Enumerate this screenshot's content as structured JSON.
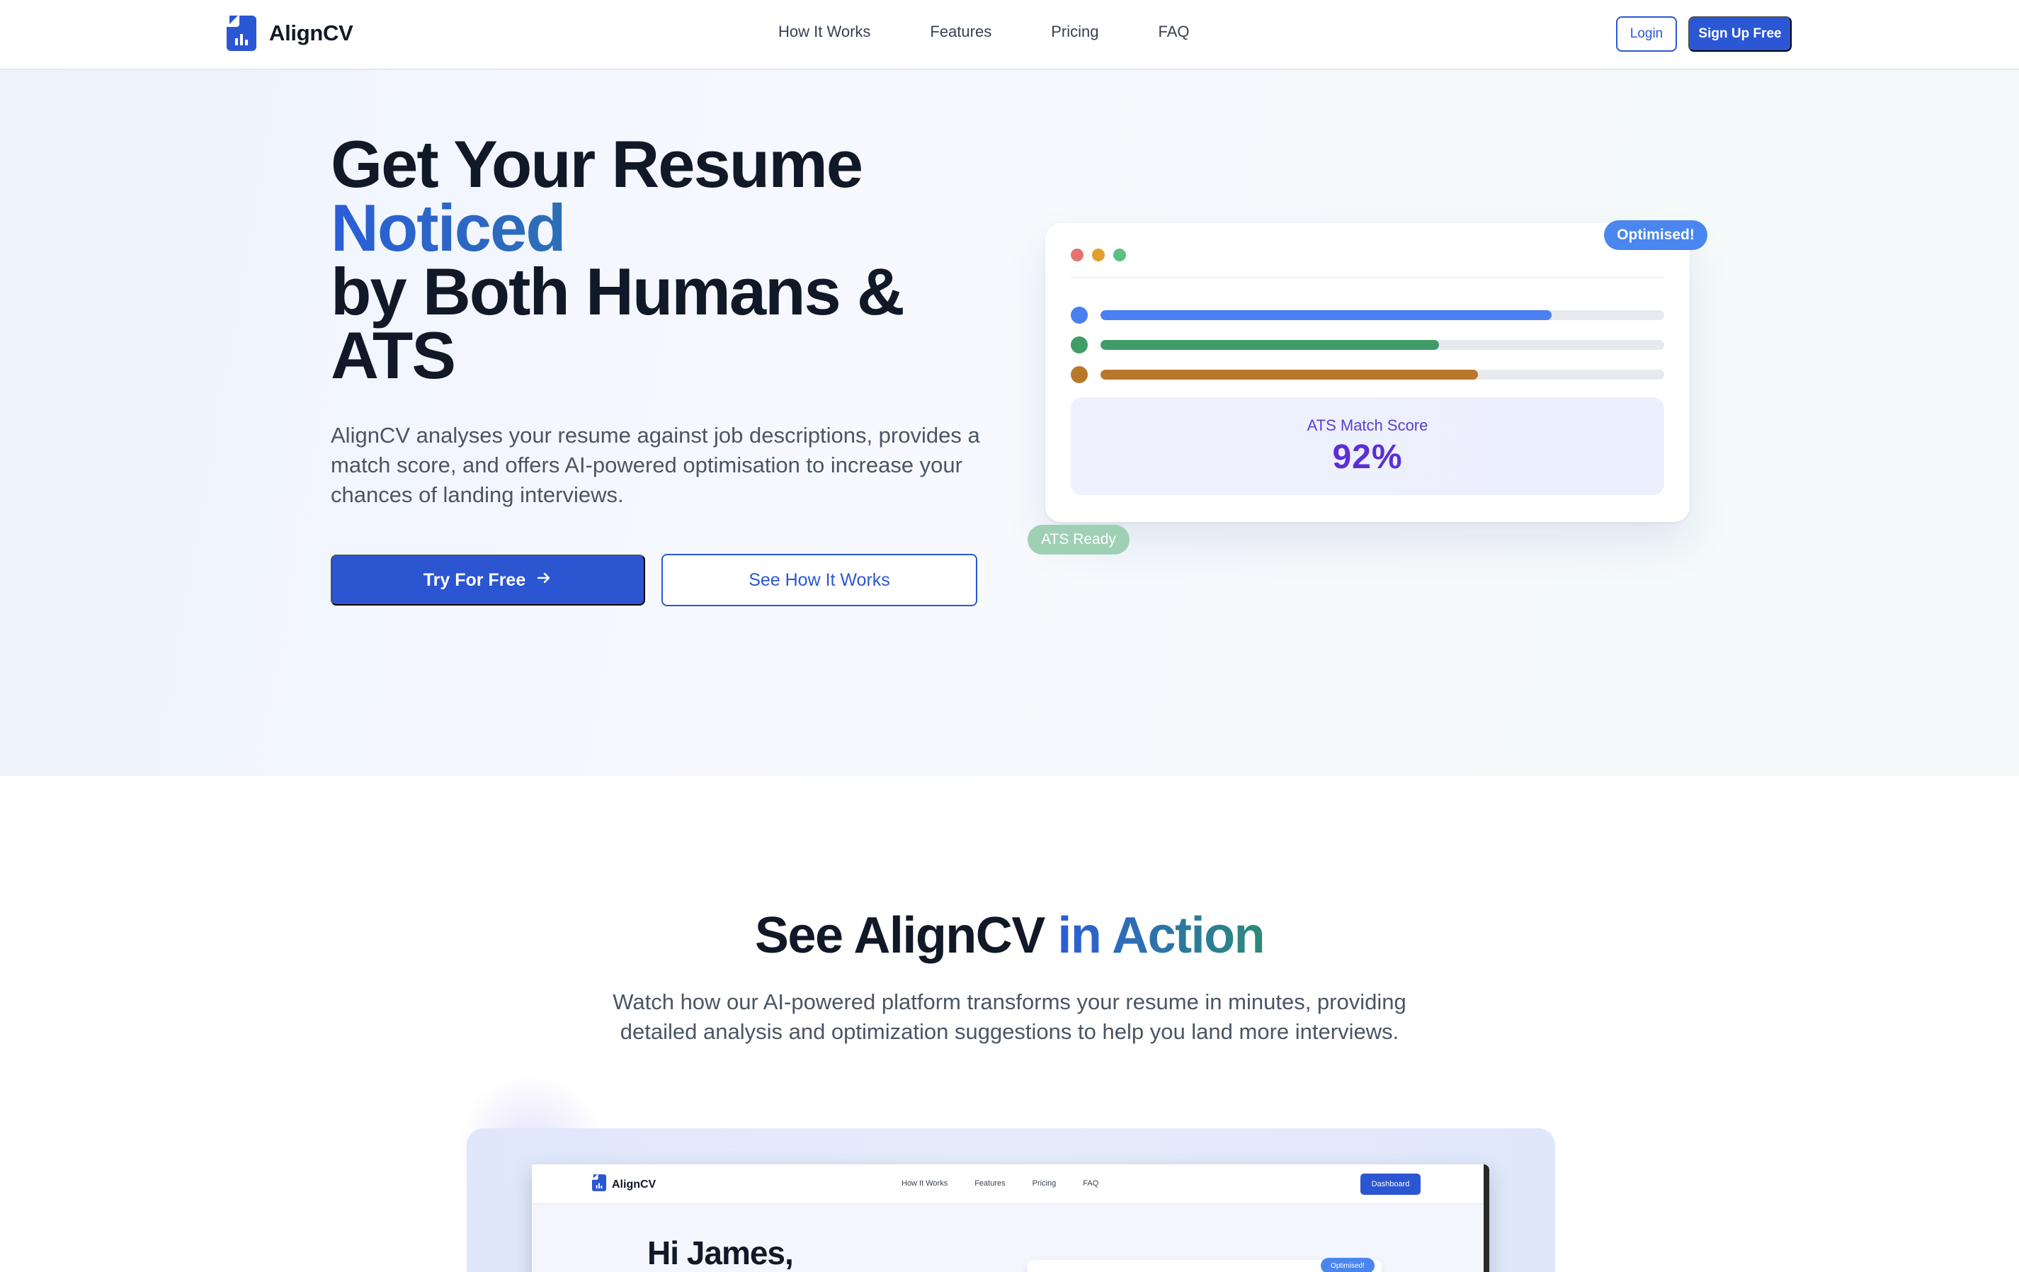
{
  "nav": {
    "brand": "AlignCV",
    "links": [
      "How It Works",
      "Features",
      "Pricing",
      "FAQ"
    ],
    "login_label": "Login",
    "signup_label": "Sign Up Free"
  },
  "hero": {
    "title_line1": "Get Your Resume",
    "title_highlight": "Noticed",
    "title_line3": "by Both Humans &",
    "title_line4": "ATS",
    "description": "AlignCV analyses your resume against job descriptions, provides a match score, and offers AI-powered optimisation to increase your chances of landing interviews.",
    "primary_cta": "Try For Free",
    "secondary_cta": "See How It Works"
  },
  "preview_card": {
    "window_dot_colors": [
      "#e57373",
      "#e0a030",
      "#5cbf84"
    ],
    "bars": [
      {
        "color": "#4a7ff0",
        "fill": 0.8
      },
      {
        "color": "#3f9c67",
        "fill": 0.6
      },
      {
        "color": "#b97829",
        "fill": 0.67
      }
    ],
    "score_label": "ATS Match Score",
    "score_value": "92%",
    "badge_top": "Optimised!",
    "badge_bottom": "ATS Ready"
  },
  "action_section": {
    "title_plain": "See AlignCV",
    "title_highlight": "in Action",
    "description": "Watch how our AI-powered platform transforms your resume in minutes, providing detailed analysis and optimization suggestions to help you land more interviews."
  },
  "mini_preview": {
    "brand": "AlignCV",
    "links": [
      "How It Works",
      "Features",
      "Pricing",
      "FAQ"
    ],
    "dashboard_label": "Dashboard",
    "greeting": "Hi James,",
    "badge": "Optimised!"
  },
  "colors": {
    "primary": "#2b57d4",
    "gradient_start": "#2b5ed8",
    "gradient_end": "#2d8a7a",
    "score": "#5b2fd6"
  }
}
